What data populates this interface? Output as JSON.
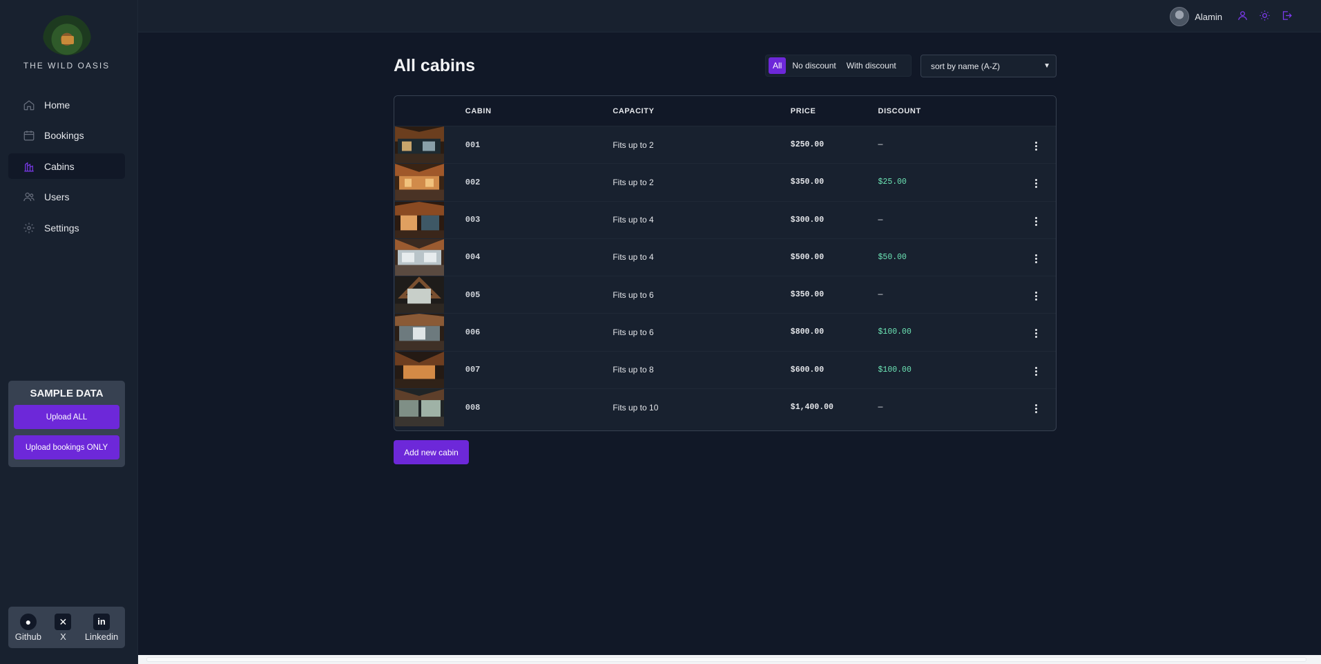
{
  "brand": {
    "name": "THE WILD OASIS"
  },
  "nav": [
    {
      "label": "Home",
      "icon": "home-icon"
    },
    {
      "label": "Bookings",
      "icon": "calendar-icon"
    },
    {
      "label": "Cabins",
      "icon": "cabins-icon",
      "active": true
    },
    {
      "label": "Users",
      "icon": "users-icon"
    },
    {
      "label": "Settings",
      "icon": "settings-icon"
    }
  ],
  "sample": {
    "title": "SAMPLE DATA",
    "upload_all": "Upload ALL",
    "upload_bookings": "Upload bookings ONLY"
  },
  "social": [
    {
      "label": "Github",
      "icon": "github-icon"
    },
    {
      "label": "X",
      "icon": "x-icon"
    },
    {
      "label": "Linkedin",
      "icon": "linkedin-icon"
    }
  ],
  "user": {
    "name": "Alamin"
  },
  "page": {
    "title": "All cabins"
  },
  "filter": {
    "all": "All",
    "no_discount": "No discount",
    "with_discount": "With discount",
    "active": "all"
  },
  "sort": {
    "selected": "sort by name (A-Z)"
  },
  "table": {
    "headers": {
      "cabin": "CABIN",
      "capacity": "CAPACITY",
      "price": "PRICE",
      "discount": "DISCOUNT"
    },
    "rows": [
      {
        "name": "001",
        "capacity": "Fits up to 2",
        "price": "$250.00",
        "discount": "—"
      },
      {
        "name": "002",
        "capacity": "Fits up to 2",
        "price": "$350.00",
        "discount": "$25.00"
      },
      {
        "name": "003",
        "capacity": "Fits up to 4",
        "price": "$300.00",
        "discount": "—"
      },
      {
        "name": "004",
        "capacity": "Fits up to 4",
        "price": "$500.00",
        "discount": "$50.00"
      },
      {
        "name": "005",
        "capacity": "Fits up to 6",
        "price": "$350.00",
        "discount": "—"
      },
      {
        "name": "006",
        "capacity": "Fits up to 6",
        "price": "$800.00",
        "discount": "$100.00"
      },
      {
        "name": "007",
        "capacity": "Fits up to 8",
        "price": "$600.00",
        "discount": "$100.00"
      },
      {
        "name": "008",
        "capacity": "Fits up to 10",
        "price": "$1,400.00",
        "discount": "—"
      }
    ]
  },
  "actions": {
    "add_cabin": "Add new cabin"
  },
  "colors": {
    "accent": "#6d28d9",
    "discount": "#6ee7b7",
    "bg": "#111827",
    "panel": "#18212f"
  }
}
